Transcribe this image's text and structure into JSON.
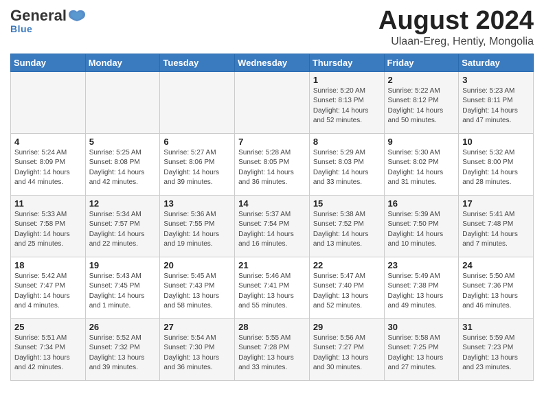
{
  "header": {
    "logo_general": "General",
    "logo_blue": "Blue",
    "main_title": "August 2024",
    "subtitle": "Ulaan-Ereg, Hentiy, Mongolia"
  },
  "weekdays": [
    "Sunday",
    "Monday",
    "Tuesday",
    "Wednesday",
    "Thursday",
    "Friday",
    "Saturday"
  ],
  "weeks": [
    [
      {
        "day": "",
        "detail": ""
      },
      {
        "day": "",
        "detail": ""
      },
      {
        "day": "",
        "detail": ""
      },
      {
        "day": "",
        "detail": ""
      },
      {
        "day": "1",
        "detail": "Sunrise: 5:20 AM\nSunset: 8:13 PM\nDaylight: 14 hours\nand 52 minutes."
      },
      {
        "day": "2",
        "detail": "Sunrise: 5:22 AM\nSunset: 8:12 PM\nDaylight: 14 hours\nand 50 minutes."
      },
      {
        "day": "3",
        "detail": "Sunrise: 5:23 AM\nSunset: 8:11 PM\nDaylight: 14 hours\nand 47 minutes."
      }
    ],
    [
      {
        "day": "4",
        "detail": "Sunrise: 5:24 AM\nSunset: 8:09 PM\nDaylight: 14 hours\nand 44 minutes."
      },
      {
        "day": "5",
        "detail": "Sunrise: 5:25 AM\nSunset: 8:08 PM\nDaylight: 14 hours\nand 42 minutes."
      },
      {
        "day": "6",
        "detail": "Sunrise: 5:27 AM\nSunset: 8:06 PM\nDaylight: 14 hours\nand 39 minutes."
      },
      {
        "day": "7",
        "detail": "Sunrise: 5:28 AM\nSunset: 8:05 PM\nDaylight: 14 hours\nand 36 minutes."
      },
      {
        "day": "8",
        "detail": "Sunrise: 5:29 AM\nSunset: 8:03 PM\nDaylight: 14 hours\nand 33 minutes."
      },
      {
        "day": "9",
        "detail": "Sunrise: 5:30 AM\nSunset: 8:02 PM\nDaylight: 14 hours\nand 31 minutes."
      },
      {
        "day": "10",
        "detail": "Sunrise: 5:32 AM\nSunset: 8:00 PM\nDaylight: 14 hours\nand 28 minutes."
      }
    ],
    [
      {
        "day": "11",
        "detail": "Sunrise: 5:33 AM\nSunset: 7:58 PM\nDaylight: 14 hours\nand 25 minutes."
      },
      {
        "day": "12",
        "detail": "Sunrise: 5:34 AM\nSunset: 7:57 PM\nDaylight: 14 hours\nand 22 minutes."
      },
      {
        "day": "13",
        "detail": "Sunrise: 5:36 AM\nSunset: 7:55 PM\nDaylight: 14 hours\nand 19 minutes."
      },
      {
        "day": "14",
        "detail": "Sunrise: 5:37 AM\nSunset: 7:54 PM\nDaylight: 14 hours\nand 16 minutes."
      },
      {
        "day": "15",
        "detail": "Sunrise: 5:38 AM\nSunset: 7:52 PM\nDaylight: 14 hours\nand 13 minutes."
      },
      {
        "day": "16",
        "detail": "Sunrise: 5:39 AM\nSunset: 7:50 PM\nDaylight: 14 hours\nand 10 minutes."
      },
      {
        "day": "17",
        "detail": "Sunrise: 5:41 AM\nSunset: 7:48 PM\nDaylight: 14 hours\nand 7 minutes."
      }
    ],
    [
      {
        "day": "18",
        "detail": "Sunrise: 5:42 AM\nSunset: 7:47 PM\nDaylight: 14 hours\nand 4 minutes."
      },
      {
        "day": "19",
        "detail": "Sunrise: 5:43 AM\nSunset: 7:45 PM\nDaylight: 14 hours\nand 1 minute."
      },
      {
        "day": "20",
        "detail": "Sunrise: 5:45 AM\nSunset: 7:43 PM\nDaylight: 13 hours\nand 58 minutes."
      },
      {
        "day": "21",
        "detail": "Sunrise: 5:46 AM\nSunset: 7:41 PM\nDaylight: 13 hours\nand 55 minutes."
      },
      {
        "day": "22",
        "detail": "Sunrise: 5:47 AM\nSunset: 7:40 PM\nDaylight: 13 hours\nand 52 minutes."
      },
      {
        "day": "23",
        "detail": "Sunrise: 5:49 AM\nSunset: 7:38 PM\nDaylight: 13 hours\nand 49 minutes."
      },
      {
        "day": "24",
        "detail": "Sunrise: 5:50 AM\nSunset: 7:36 PM\nDaylight: 13 hours\nand 46 minutes."
      }
    ],
    [
      {
        "day": "25",
        "detail": "Sunrise: 5:51 AM\nSunset: 7:34 PM\nDaylight: 13 hours\nand 42 minutes."
      },
      {
        "day": "26",
        "detail": "Sunrise: 5:52 AM\nSunset: 7:32 PM\nDaylight: 13 hours\nand 39 minutes."
      },
      {
        "day": "27",
        "detail": "Sunrise: 5:54 AM\nSunset: 7:30 PM\nDaylight: 13 hours\nand 36 minutes."
      },
      {
        "day": "28",
        "detail": "Sunrise: 5:55 AM\nSunset: 7:28 PM\nDaylight: 13 hours\nand 33 minutes."
      },
      {
        "day": "29",
        "detail": "Sunrise: 5:56 AM\nSunset: 7:27 PM\nDaylight: 13 hours\nand 30 minutes."
      },
      {
        "day": "30",
        "detail": "Sunrise: 5:58 AM\nSunset: 7:25 PM\nDaylight: 13 hours\nand 27 minutes."
      },
      {
        "day": "31",
        "detail": "Sunrise: 5:59 AM\nSunset: 7:23 PM\nDaylight: 13 hours\nand 23 minutes."
      }
    ]
  ]
}
